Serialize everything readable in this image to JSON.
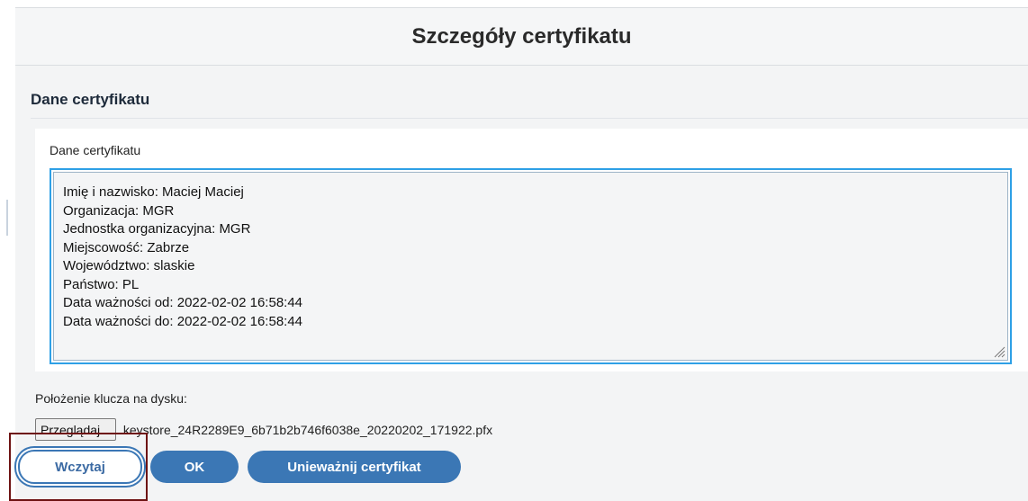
{
  "dialog": {
    "title": "Szczegóły certyfikatu"
  },
  "section": {
    "title": "Dane certyfikatu"
  },
  "certificate": {
    "label": "Dane certyfikatu",
    "lines": [
      "Imię i nazwisko: Maciej Maciej",
      "Organizacja: MGR",
      "Jednostka organizacyjna: MGR",
      "Miejscowość: Zabrze",
      "Województwo: slaskie",
      "Państwo: PL",
      "Data ważności od: 2022-02-02 16:58:44",
      "Data ważności do: 2022-02-02 16:58:44"
    ]
  },
  "key": {
    "label": "Położenie klucza na dysku:",
    "browse_label": "Przeglądaj...",
    "file_name": "keystore_24R2289E9_6b71b2b746f6038e_20220202_171922.pfx"
  },
  "buttons": {
    "load": "Wczytaj",
    "ok": "OK",
    "revoke": "Unieważnij certyfikat"
  },
  "colors": {
    "accent": "#3b77b5",
    "textarea_border": "#2ea0e6",
    "highlight": "#6e1212"
  }
}
